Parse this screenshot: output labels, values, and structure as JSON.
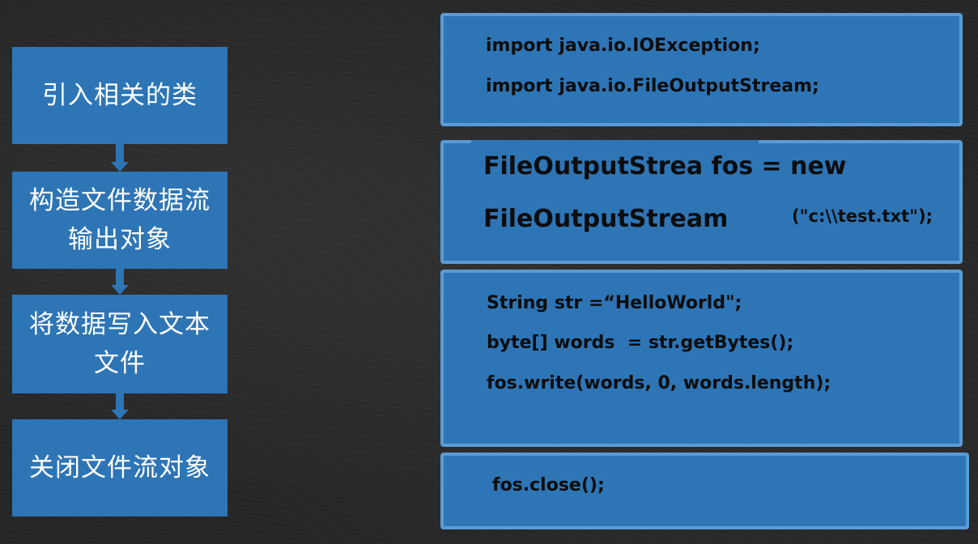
{
  "steps": [
    {
      "label": "引入相关的类"
    },
    {
      "label": "构造文件数据流输出对象"
    },
    {
      "label": "将数据写入文本文件"
    },
    {
      "label": "关闭文件流对象"
    }
  ],
  "code_blocks": [
    {
      "lines": [
        "import java.io.IOException;",
        "import java.io.FileOutputStream;"
      ]
    },
    {
      "lines": [
        "FileOutputStrea fos = new",
        "FileOutputStream",
        "(\"c:\\\\test.txt\");"
      ]
    },
    {
      "lines": [
        "String str =“HelloWorld\";",
        "byte[] words  = str.getBytes();",
        "fos.write(words, 0, words.length);"
      ]
    },
    {
      "lines": [
        "fos.close();"
      ]
    }
  ],
  "colors": {
    "box_fill": "#2e75b6",
    "box_border": "#5b9bd5",
    "background": "#262626"
  }
}
